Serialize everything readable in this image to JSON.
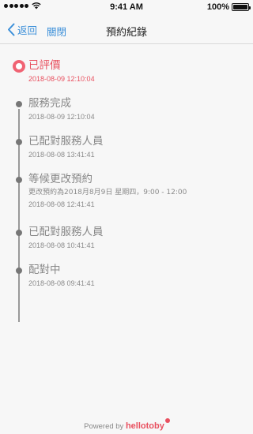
{
  "status_bar": {
    "time": "9:41 AM",
    "battery": "100%"
  },
  "nav": {
    "back_label": "返回",
    "close_label": "關閉",
    "title": "預約紀錄"
  },
  "timeline": [
    {
      "title": "已評價",
      "date": "2018-08-09 12:10:04",
      "active": true
    },
    {
      "title": "服務完成",
      "date": "2018-08-09 12:10:04"
    },
    {
      "title": "已配對服務人員",
      "date": "2018-08-08 13:41:41"
    },
    {
      "title": "等候更改預約",
      "detail": "更改預約為2018月8月9日 星期四，9:00 - 12:00",
      "date": "2018-08-08 12:41:41"
    },
    {
      "title": "已配對服務人員",
      "date": "2018-08-08 10:41:41"
    },
    {
      "title": "配對中",
      "date": "2018-08-08 09:41:41"
    }
  ],
  "footer": {
    "powered_by": "Powered by",
    "brand": "hellotoby"
  },
  "colors": {
    "accent": "#e8505f",
    "link": "#3b8fd9"
  }
}
